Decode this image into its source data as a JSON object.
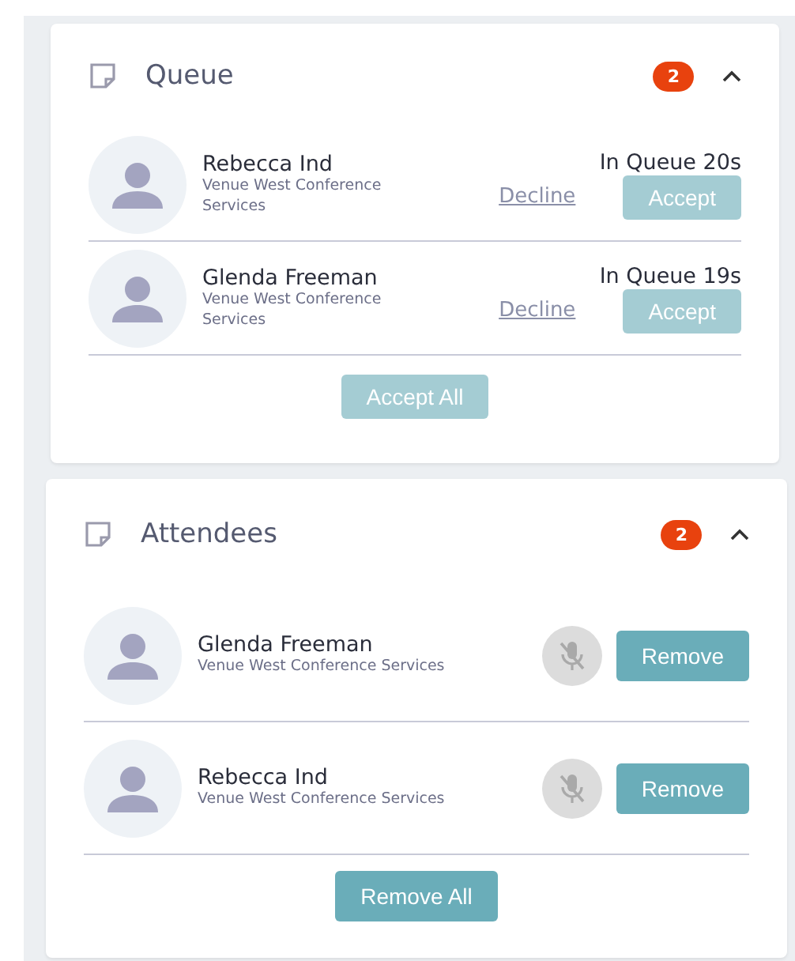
{
  "queue": {
    "title": "Queue",
    "count": "2",
    "expanded": true,
    "items": [
      {
        "name": "Rebecca Ind",
        "company": "Venue West Conference Services",
        "wait": "In Queue 20s",
        "decline": "Decline",
        "accept": "Accept",
        "disabled": true
      },
      {
        "name": "Glenda Freeman",
        "company": "Venue West Conference Services",
        "wait": "In Queue 19s",
        "decline": "Decline",
        "accept": "Accept",
        "disabled": true
      }
    ],
    "accept_all": {
      "label": "Accept All",
      "disabled": true
    }
  },
  "attendees": {
    "title": "Attendees",
    "count": "2",
    "expanded": true,
    "items": [
      {
        "name": "Glenda Freeman",
        "company": "Venue West Conference Services",
        "muted": true,
        "remove": "Remove"
      },
      {
        "name": "Rebecca Ind",
        "company": "Venue West Conference Services",
        "muted": true,
        "remove": "Remove"
      }
    ],
    "remove_all": {
      "label": "Remove All"
    }
  }
}
